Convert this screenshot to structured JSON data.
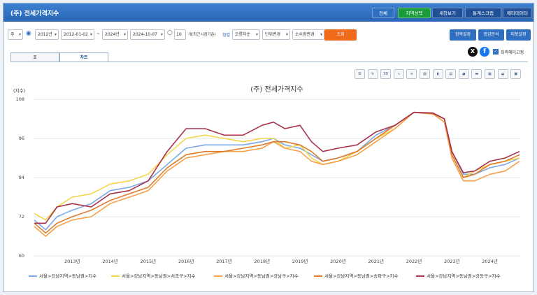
{
  "window": {
    "title": "(주) 전세가격지수",
    "top_buttons": [
      {
        "label": "전체",
        "color": "#2f6fc0"
      },
      {
        "label": "지역선택",
        "color": "#1a9c3a"
      },
      {
        "label": "새창보기",
        "color": "#1f4f94"
      },
      {
        "label": "통계스크랩",
        "color": "#1f4f94"
      },
      {
        "label": "메타데이터",
        "color": "#1f4f94"
      }
    ]
  },
  "toolbar": {
    "period": "주",
    "start_year": "2012년",
    "start_date": "2012-01-02",
    "sep": "~",
    "end_year": "2024년",
    "end_date": "2024-10-07",
    "recent_count": "10",
    "recent_label": "개(최근시점기준)",
    "sort_label": "정렬",
    "sort_value": "오름차순",
    "unit_value": "단위변경",
    "decimal_value": "소수점변경",
    "search_button": "조회",
    "right_buttons": [
      "항목설정",
      "증감분석",
      "피봇설정"
    ]
  },
  "tabs": [
    "표",
    "차트"
  ],
  "share": {
    "x_icon": "x-icon",
    "fb_icon": "facebook-icon",
    "fixed_header_label": "좌측헤더고정",
    "fixed_header_checked": true
  },
  "chart_tools": [
    "list",
    "refresh",
    "3D",
    "line",
    "line-multi",
    "area",
    "bar",
    "bar-stack",
    "pie",
    "bar-h",
    "bar-h-stack",
    "bar-pie",
    "save"
  ],
  "chart_data": {
    "type": "line",
    "title": "(주) 전세가격지수",
    "ylabel": "(지수)",
    "ylim": [
      60,
      108
    ],
    "yticks": [
      60,
      72,
      84,
      96,
      108
    ],
    "xticks": [
      "2013년",
      "2014년",
      "2015년",
      "2016년",
      "2017년",
      "2018년",
      "2019년",
      "2020년",
      "2021년",
      "2022년",
      "2023년",
      "2024년"
    ],
    "xrange": [
      2012.0,
      2024.78
    ],
    "series": [
      {
        "name": "서울>강남지역>동남권>지수",
        "color": "#7aa8e8",
        "x": [
          2012.0,
          2012.3,
          2012.6,
          2013.0,
          2013.5,
          2014.0,
          2014.5,
          2015.0,
          2015.5,
          2016.0,
          2016.5,
          2017.0,
          2017.5,
          2018.0,
          2018.3,
          2018.6,
          2019.0,
          2019.3,
          2019.6,
          2020.0,
          2020.5,
          2021.0,
          2021.5,
          2022.0,
          2022.5,
          2022.8,
          2023.0,
          2023.3,
          2023.6,
          2024.0,
          2024.4,
          2024.78
        ],
        "y": [
          71,
          68,
          72,
          74,
          76,
          80,
          81,
          83,
          88,
          93,
          94,
          94,
          94,
          95,
          96,
          94,
          93,
          91,
          89,
          90,
          92,
          97,
          100,
          104,
          103.5,
          102,
          92,
          85,
          85,
          87,
          88,
          90
        ]
      },
      {
        "name": "서울>강남지역>동남권>서초구>지수",
        "color": "#f5d44a",
        "x": [
          2012.0,
          2012.3,
          2012.6,
          2013.0,
          2013.5,
          2014.0,
          2014.5,
          2015.0,
          2015.5,
          2016.0,
          2016.5,
          2017.0,
          2017.5,
          2018.0,
          2018.3,
          2018.6,
          2019.0,
          2019.3,
          2019.6,
          2020.0,
          2020.5,
          2021.0,
          2021.5,
          2022.0,
          2022.5,
          2022.8,
          2023.0,
          2023.3,
          2023.6,
          2024.0,
          2024.4,
          2024.78
        ],
        "y": [
          73,
          71,
          75,
          78,
          79,
          82,
          83,
          85,
          91,
          96,
          97,
          96,
          95,
          96,
          96,
          93,
          94,
          90,
          88,
          89,
          92,
          96,
          99,
          104,
          103.5,
          102,
          91,
          84,
          86,
          88,
          89,
          90
        ]
      },
      {
        "name": "서울>강남지역>동남권>강남구>지수",
        "color": "#f5a14a",
        "x": [
          2012.0,
          2012.3,
          2012.6,
          2013.0,
          2013.5,
          2014.0,
          2014.5,
          2015.0,
          2015.5,
          2016.0,
          2016.5,
          2017.0,
          2017.5,
          2018.0,
          2018.3,
          2018.6,
          2019.0,
          2019.3,
          2019.6,
          2020.0,
          2020.5,
          2021.0,
          2021.5,
          2022.0,
          2022.5,
          2022.8,
          2023.0,
          2023.3,
          2023.6,
          2024.0,
          2024.4,
          2024.78
        ],
        "y": [
          69,
          66,
          69,
          71,
          72,
          76,
          78,
          80,
          86,
          90,
          91,
          92,
          92,
          93,
          95,
          93,
          92,
          89,
          88,
          89,
          91,
          95,
          99,
          104,
          103.5,
          101,
          90,
          83,
          83,
          85,
          86,
          89
        ]
      },
      {
        "name": "서울>강남지역>동남권>송파구>지수",
        "color": "#e07a2a",
        "x": [
          2012.0,
          2012.3,
          2012.6,
          2013.0,
          2013.5,
          2014.0,
          2014.5,
          2015.0,
          2015.5,
          2016.0,
          2016.5,
          2017.0,
          2017.5,
          2018.0,
          2018.3,
          2018.6,
          2019.0,
          2019.3,
          2019.6,
          2020.0,
          2020.5,
          2021.0,
          2021.5,
          2022.0,
          2022.5,
          2022.8,
          2023.0,
          2023.3,
          2023.6,
          2024.0,
          2024.4,
          2024.78
        ],
        "y": [
          70,
          67,
          70,
          72,
          74,
          77,
          79,
          81,
          87,
          91,
          92,
          92,
          93,
          94,
          95,
          95,
          94,
          92,
          89,
          90,
          92,
          96,
          100,
          104,
          103.5,
          102,
          91,
          84,
          85,
          88,
          89,
          91
        ]
      },
      {
        "name": "서울>강남지역>동남권>강동구>지수",
        "color": "#a8334a",
        "x": [
          2012.0,
          2012.3,
          2012.6,
          2013.0,
          2013.5,
          2014.0,
          2014.5,
          2015.0,
          2015.5,
          2016.0,
          2016.5,
          2017.0,
          2017.5,
          2018.0,
          2018.3,
          2018.6,
          2019.0,
          2019.3,
          2019.6,
          2020.0,
          2020.5,
          2021.0,
          2021.5,
          2022.0,
          2022.5,
          2022.8,
          2023.0,
          2023.3,
          2023.6,
          2024.0,
          2024.4,
          2024.78
        ],
        "y": [
          70,
          70,
          75,
          76,
          75,
          79,
          80,
          83,
          92,
          99,
          99,
          97,
          97,
          100,
          101,
          99,
          100,
          95,
          92,
          93,
          94,
          98,
          100,
          104,
          103.8,
          102,
          92,
          85.5,
          86,
          89,
          90,
          92
        ]
      }
    ]
  }
}
